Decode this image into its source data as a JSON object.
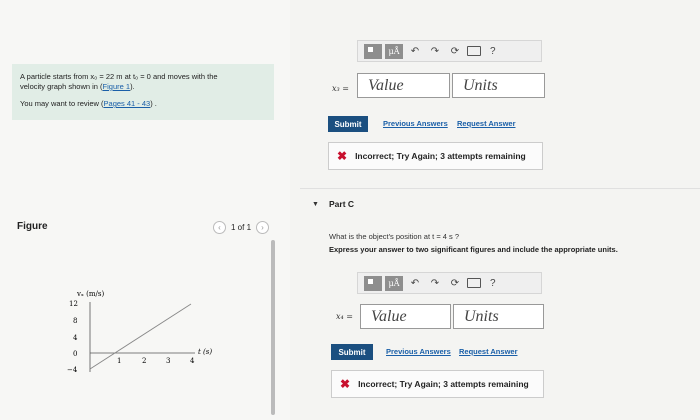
{
  "problem": {
    "line1": "A particle starts from x₀ = 22 m at t₀ = 0 and moves with the",
    "line2_prefix": "velocity graph shown in (",
    "line2_link": "Figure 1",
    "line2_suffix": ").",
    "review_prefix": "You may want to review (",
    "review_link": "Pages 41 - 43",
    "review_suffix": ") ."
  },
  "figure": {
    "label": "Figure",
    "pager_text": "1 of 1",
    "prev_icon": "chevron-left",
    "next_icon": "chevron-right"
  },
  "graph": {
    "y_label": "vₓ (m/s)",
    "x_label": "t (s)",
    "y_ticks": [
      "12",
      "8",
      "4",
      "0",
      "−4"
    ],
    "x_ticks": [
      "1",
      "2",
      "3",
      "4"
    ]
  },
  "toolbar": {
    "mu_label": "μÅ",
    "undo_icon": "undo-arrow",
    "redo_icon": "redo-arrow",
    "reset_icon": "reset-circle",
    "keyboard_icon": "keyboard",
    "help": "?"
  },
  "partb": {
    "var_label": "x₃ =",
    "value_placeholder": "Value",
    "units_placeholder": "Units",
    "submit": "Submit",
    "previous_answers": "Previous Answers",
    "request_answer": "Request Answer",
    "feedback": "Incorrect; Try Again; 3 attempts remaining"
  },
  "partc": {
    "title": "Part C",
    "question": "What is the object's position at t = 4 s ?",
    "instruction": "Express your answer to two significant figures and include the appropriate units.",
    "var_label": "x₄ =",
    "value_placeholder": "Value",
    "units_placeholder": "Units",
    "submit": "Submit",
    "previous_answers": "Previous Answers",
    "request_answer": "Request Answer",
    "feedback": "Incorrect; Try Again; 3 attempts remaining"
  }
}
